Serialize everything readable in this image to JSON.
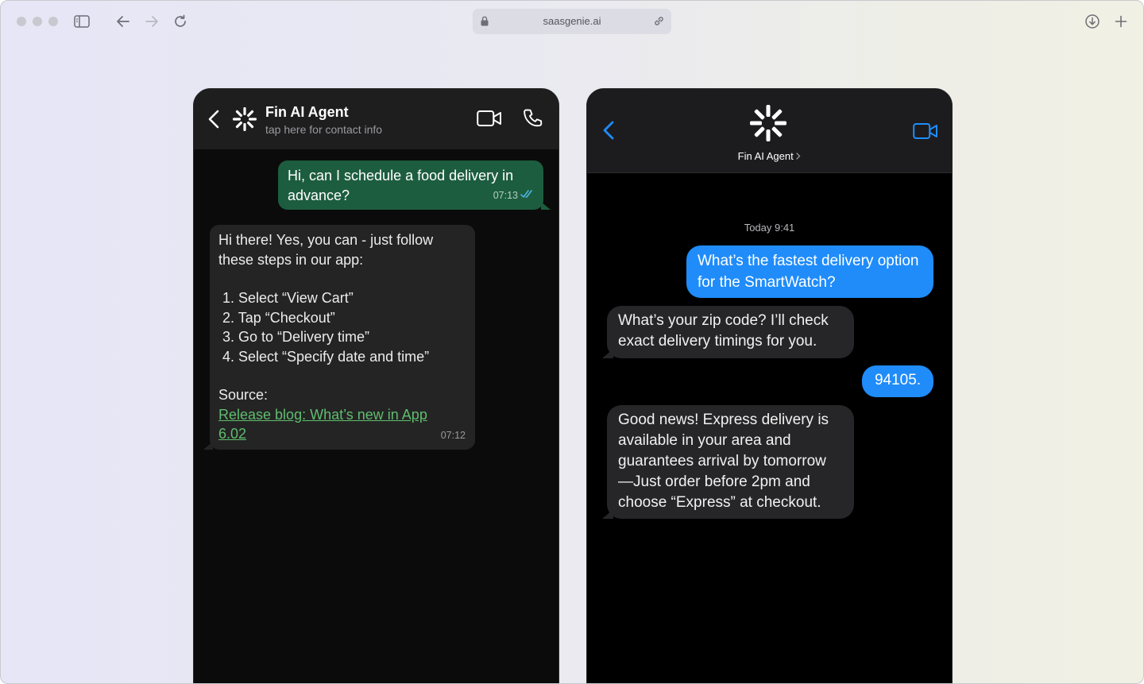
{
  "browser": {
    "url": "saasgenie.ai"
  },
  "whatsapp": {
    "contact_name": "Fin AI Agent",
    "contact_sub": "tap here for contact info",
    "outgoing": {
      "text": "Hi, can I schedule a food delivery in advance?",
      "time": "07:13"
    },
    "incoming": {
      "intro": "Hi there! Yes, you can - just follow these steps in our app:",
      "steps": [
        "1. Select “View Cart”",
        "2. Tap “Checkout”",
        "3. Go to “Delivery time”",
        "4. Select “Specify date and time”"
      ],
      "source_label": "Source:",
      "link_text": "Release blog: What’s new in App 6.02",
      "time": "07:12"
    }
  },
  "imessage": {
    "contact_name": "Fin AI Agent",
    "date_label": "Today 9:41",
    "messages": [
      {
        "from": "user",
        "text": "What’s the fastest delivery option for the SmartWatch?"
      },
      {
        "from": "agent",
        "text": "What’s your zip code? I’ll check exact delivery timings for you."
      },
      {
        "from": "user",
        "text": "94105."
      },
      {
        "from": "agent",
        "text": "Good news! Express delivery is available in your area and guarantees arrival by tomorrow —Just order before 2pm and choose “Express” at checkout."
      }
    ]
  },
  "colors": {
    "wa_outgoing": "#1d5d3f",
    "wa_incoming": "#242424",
    "wa_link": "#5fbd6e",
    "im_outgoing": "#1f8cfa",
    "im_incoming": "#262628",
    "im_accent": "#1f8cfa"
  },
  "icons": [
    "sidebar-icon",
    "back-arrow-icon",
    "forward-arrow-icon",
    "reload-icon",
    "lock-icon",
    "link-icon",
    "download-icon",
    "new-tab-icon",
    "chevron-left-icon",
    "fin-logo-icon",
    "video-call-icon",
    "phone-call-icon",
    "double-check-icon",
    "chevron-right-icon"
  ]
}
